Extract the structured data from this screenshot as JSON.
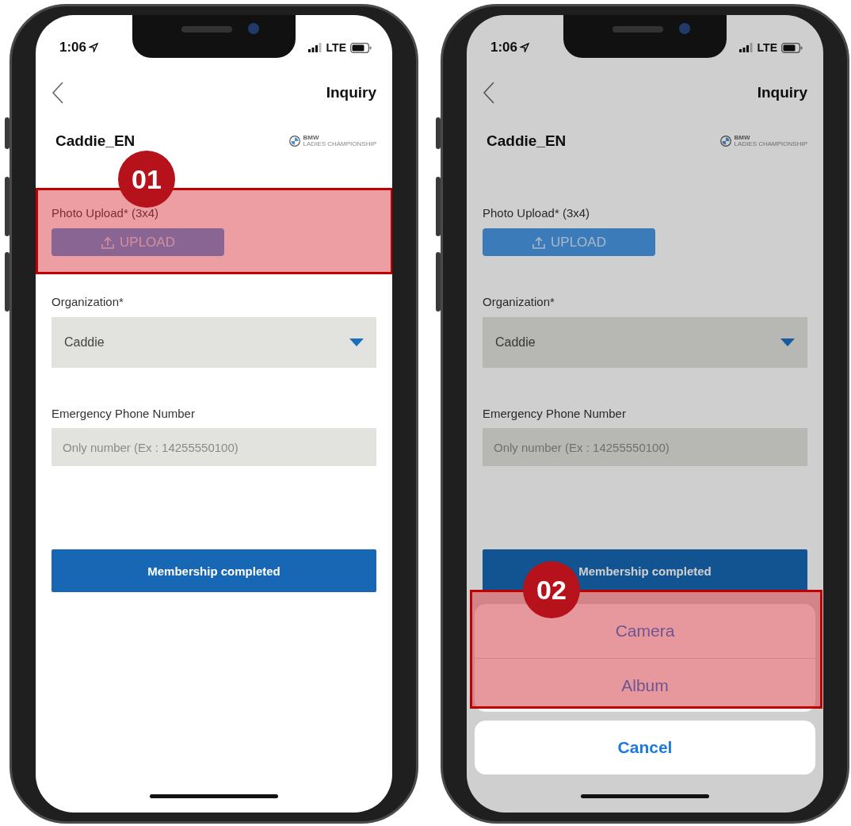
{
  "phones": [
    {
      "status_bar": {
        "time": "1:06",
        "network": "LTE"
      },
      "header": {
        "title": "Inquiry"
      },
      "page_title": "Caddie_EN",
      "logo": {
        "brand": "BMW",
        "subtitle": "LADIES CHAMPIONSHIP"
      },
      "form": {
        "photo_label": "Photo Upload* (3x4)",
        "upload_button": "UPLOAD",
        "organization_label": "Organization*",
        "organization_value": "Caddie",
        "phone_label": "Emergency Phone Number",
        "phone_placeholder": "Only number (Ex : 14255550100)",
        "highlight_badge": "01"
      },
      "submit_button": "Membership completed",
      "dimmed": false
    },
    {
      "status_bar": {
        "time": "1:06",
        "network": "LTE"
      },
      "header": {
        "title": "Inquiry"
      },
      "page_title": "Caddie_EN",
      "logo": {
        "brand": "BMW",
        "subtitle": "LADIES CHAMPIONSHIP"
      },
      "form": {
        "photo_label": "Photo Upload* (3x4)",
        "upload_button": "UPLOAD",
        "organization_label": "Organization*",
        "organization_value": "Caddie",
        "phone_label": "Emergency Phone Number",
        "phone_placeholder": "Only number (Ex : 14255550100)"
      },
      "submit_button": "Membership completed",
      "dimmed": true,
      "action_sheet": {
        "options": [
          "Camera",
          "Album"
        ],
        "cancel": "Cancel",
        "highlight_badge": "02"
      }
    }
  ]
}
